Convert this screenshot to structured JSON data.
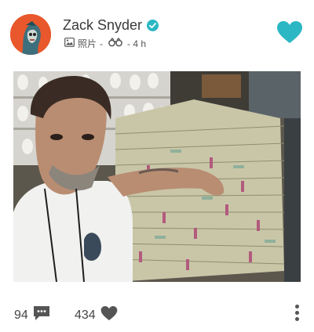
{
  "post": {
    "author": "Zack Snyder",
    "verified": true,
    "media_type_label": "照片",
    "separator": "-",
    "time_ago": "- 4 h"
  },
  "counts": {
    "comments": "94",
    "likes": "434"
  },
  "icons": {
    "verified": "verified-check-icon",
    "photo": "image-icon",
    "views": "binoculars-icon",
    "like_top": "heart-icon",
    "comment": "comment-bubble-icon",
    "like": "heart-icon",
    "more": "more-vertical-icon"
  },
  "colors": {
    "accent": "#2bb7c4",
    "avatar_bg": "#e8582c"
  }
}
